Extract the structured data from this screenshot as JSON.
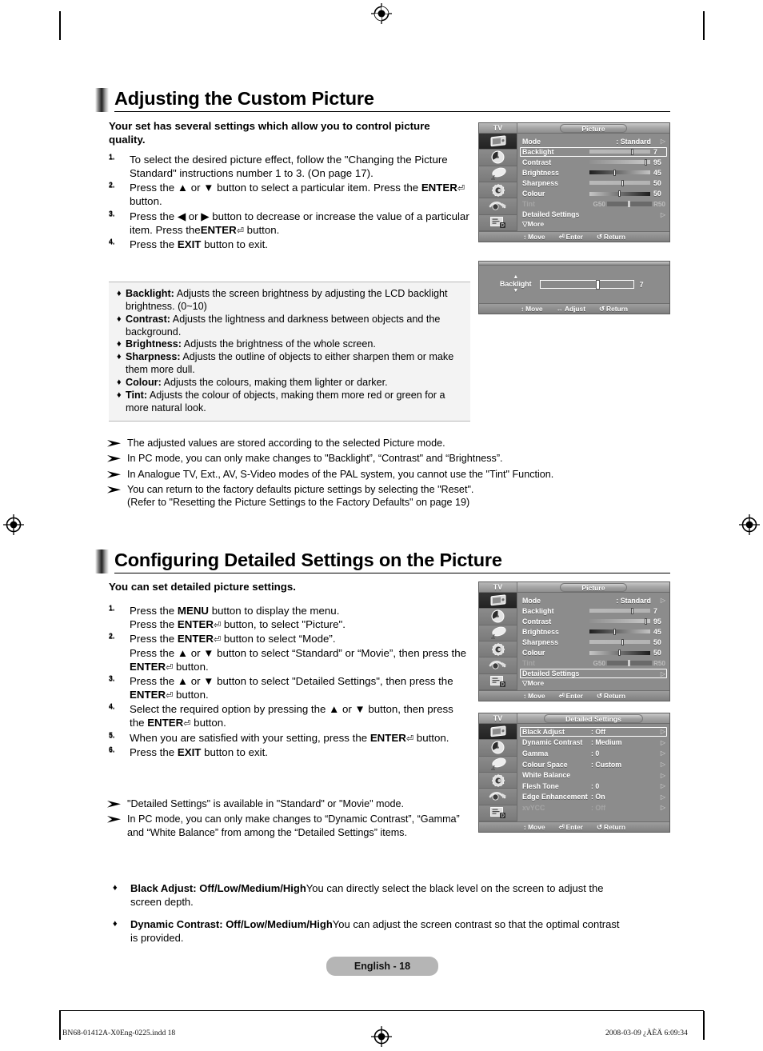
{
  "doc": {
    "section1_title": "Adjusting the Custom Picture",
    "section2_title": "Configuring Detailed Settings on the Picture",
    "intro1": "Your set has several settings which allow you to control picture quality.",
    "intro2": "You can set detailed picture settings.",
    "page_badge": "English - 18",
    "footer_left": "BN68-01412A-X0Eng-0225.indd   18",
    "footer_right": "2008-03-09   ¿ÀÈÄ 6:09:34"
  },
  "steps1": [
    {
      "num": "1.",
      "text": "To select the desired picture effect, follow the \"Changing the Picture Standard\" instructions number 1 to 3. (On page 17)."
    },
    {
      "num": "2.",
      "text": "Press the ▲ or ▼ button to select a particular item. Press the ENTER⏎ button."
    },
    {
      "num": "3.",
      "text": "Press the ◀ or ▶ button to decrease or increase the value of a particular item. Press theENTER⏎ button."
    },
    {
      "num": "4.",
      "text": "Press the EXIT button to exit."
    }
  ],
  "bullets1": [
    {
      "term": "Backlight:",
      "desc": "Adjusts the screen brightness by adjusting the LCD backlight brightness. (0~10)"
    },
    {
      "term": "Contrast:",
      "desc": "Adjusts the lightness and darkness between objects and the background."
    },
    {
      "term": "Brightness:",
      "desc": "Adjusts the brightness of the whole screen."
    },
    {
      "term": "Sharpness:",
      "desc": "Adjusts the outline of objects to either sharpen them or make them more dull."
    },
    {
      "term": "Colour:",
      "desc": "Adjusts the colours, making them lighter or darker."
    },
    {
      "term": "Tint:",
      "desc": "Adjusts the colour of objects, making them more red or green for a more natural look."
    }
  ],
  "notes1": [
    "The adjusted values are stored according to the selected Picture mode.",
    "In PC mode, you can only make changes to \"Backlight”, “Contrast\" and  “Brightness”.",
    "In Analogue TV, Ext., AV, S-Video modes of the PAL system, you cannot use the \"Tint\" Function.",
    "You can return to the factory defaults picture settings by selecting the \"Reset\".\n(Refer to \"Resetting the Picture Settings to the Factory Defaults\" on page 19)"
  ],
  "steps2": [
    {
      "num": "1.",
      "text": "Press the MENU button to display the menu.\nPress the ENTER⏎ button, to select \"Picture\"."
    },
    {
      "num": "2.",
      "text": "Press the ENTER⏎ button to select “Mode”.\nPress the ▲ or ▼ button to select “Standard” or “Movie”, then press the ENTER⏎ button."
    },
    {
      "num": "3.",
      "text": "Press the ▲ or ▼ button to select \"Detailed Settings\", then press the ENTER⏎ button."
    },
    {
      "num": "4.",
      "text": "Select the required option by pressing the ▲ or ▼ button, then press the ENTER⏎ button."
    },
    {
      "num": "5.",
      "text": "When you are satisfied with your setting, press the ENTER⏎ button."
    },
    {
      "num": "6.",
      "text": "Press the EXIT button to exit."
    }
  ],
  "notes2": [
    "\"Detailed Settings\" is available in \"Standard\" or \"Movie\" mode.",
    "In PC mode, you can only make changes to “Dynamic Contrast”, “Gamma” and “White Balance” from among the “Detailed Settings” items."
  ],
  "finals": [
    {
      "heading": "Black Adjust: Off/Low/Medium/High",
      "body": "You can directly select the black level on the screen to adjust the screen depth."
    },
    {
      "heading": "Dynamic Contrast: Off/Low/Medium/High",
      "body": "You can adjust the screen contrast so that the optimal contrast is provided."
    }
  ],
  "osd": {
    "tv_label": "TV",
    "picture_title": "Picture",
    "detailed_title": "Detailed Settings",
    "more_label": "▽More",
    "icons": [
      "picture-icon",
      "sound-icon",
      "channel-icon",
      "setup-icon",
      "input-icon",
      "pc-setup-icon"
    ],
    "footer_picture": [
      {
        "glyph": "↕",
        "label": "Move"
      },
      {
        "glyph": "⏎",
        "label": "Enter"
      },
      {
        "glyph": "↺",
        "label": "Return"
      }
    ],
    "footer_adjust": [
      {
        "glyph": "↕",
        "label": "Move"
      },
      {
        "glyph": "↔",
        "label": "Adjust"
      },
      {
        "glyph": "↺",
        "label": "Return"
      }
    ],
    "picture_menu_1": {
      "mode": {
        "label": "Mode",
        "value": ": Standard"
      },
      "rows": [
        {
          "label": "Backlight",
          "value": "7",
          "percent": 68,
          "selected": true,
          "fill": "flat"
        },
        {
          "label": "Contrast",
          "value": "95",
          "percent": 91,
          "selected": false,
          "fill": "grad-light"
        },
        {
          "label": "Brightness",
          "value": "45",
          "percent": 40,
          "selected": false,
          "fill": "grad-dark"
        },
        {
          "label": "Sharpness",
          "value": "50",
          "percent": 52,
          "selected": false,
          "fill": "flat"
        },
        {
          "label": "Colour",
          "value": "50",
          "percent": 48,
          "selected": false,
          "fill": "grad-rev"
        }
      ],
      "tint": {
        "label": "Tint",
        "left": "G50",
        "right": "R50",
        "percent": 47
      },
      "detailed": {
        "label": "Detailed Settings",
        "selected": false
      }
    },
    "picture_menu_2": {
      "mode": {
        "label": "Mode",
        "value": ": Standard"
      },
      "rows": [
        {
          "label": "Backlight",
          "value": "7",
          "percent": 68,
          "selected": false,
          "fill": "flat"
        },
        {
          "label": "Contrast",
          "value": "95",
          "percent": 91,
          "selected": false,
          "fill": "grad-light"
        },
        {
          "label": "Brightness",
          "value": "45",
          "percent": 40,
          "selected": false,
          "fill": "grad-dark"
        },
        {
          "label": "Sharpness",
          "value": "50",
          "percent": 52,
          "selected": false,
          "fill": "flat"
        },
        {
          "label": "Colour",
          "value": "50",
          "percent": 48,
          "selected": false,
          "fill": "grad-rev"
        }
      ],
      "tint": {
        "label": "Tint",
        "left": "G50",
        "right": "R50",
        "percent": 47
      },
      "detailed": {
        "label": "Detailed Settings",
        "selected": true
      }
    },
    "adjust_bar": {
      "label": "Backlight",
      "value": "7",
      "percent": 60
    },
    "detailed_menu": {
      "rows": [
        {
          "label": "Black Adjust",
          "value": ": Off",
          "selected": true,
          "dim": false
        },
        {
          "label": "Dynamic Contrast",
          "value": ": Medium",
          "selected": false,
          "dim": false
        },
        {
          "label": "Gamma",
          "value": ": 0",
          "selected": false,
          "dim": false
        },
        {
          "label": "Colour Space",
          "value": ": Custom",
          "selected": false,
          "dim": false
        },
        {
          "label": "White Balance",
          "value": "",
          "selected": false,
          "dim": false
        },
        {
          "label": "Flesh Tone",
          "value": ": 0",
          "selected": false,
          "dim": false
        },
        {
          "label": "Edge Enhancement",
          "value": ": On",
          "selected": false,
          "dim": false
        },
        {
          "label": "xvYCC",
          "value": ": Off",
          "selected": false,
          "dim": true
        }
      ]
    }
  }
}
